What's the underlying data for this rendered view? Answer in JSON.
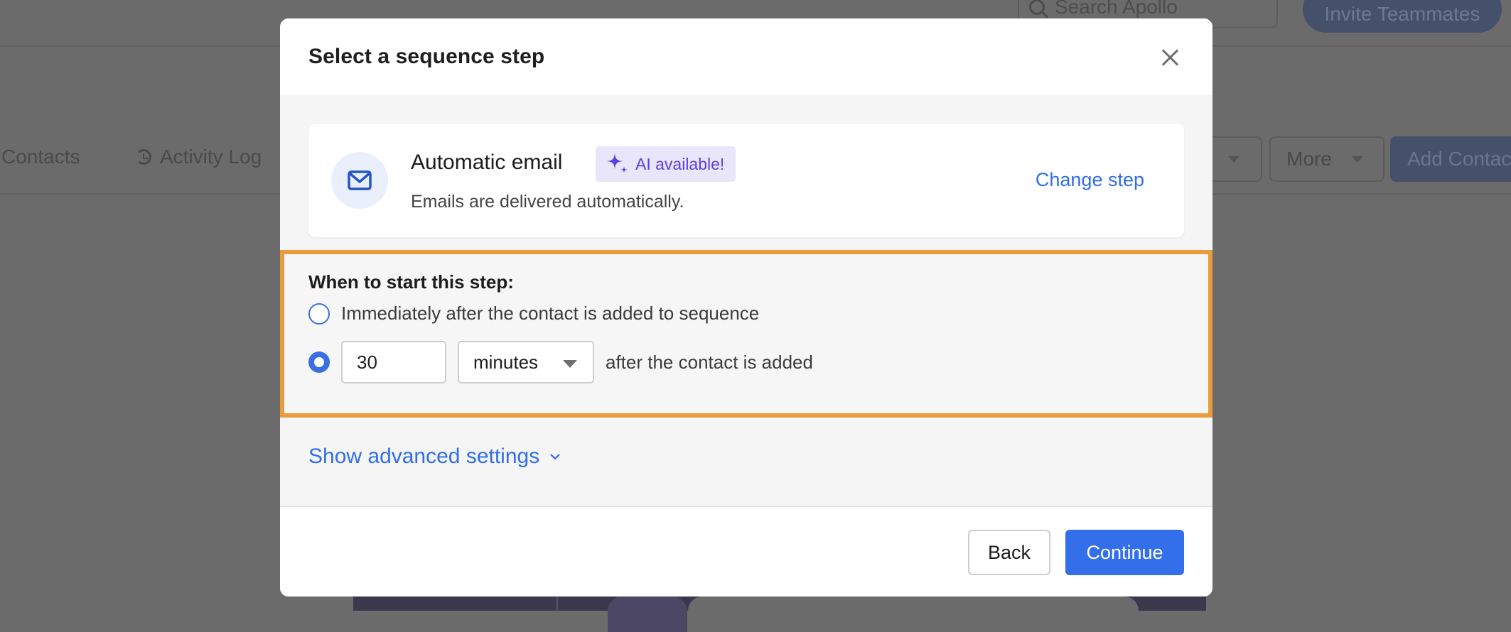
{
  "background": {
    "search_placeholder": "Search Apollo",
    "invite_button": "Invite Teammates",
    "tabs": [
      {
        "label": "Contacts"
      },
      {
        "label": "Activity Log",
        "icon": "history-icon"
      }
    ],
    "more_button": "More",
    "add_contacts_button": "Add Contac"
  },
  "modal": {
    "title": "Select a sequence step",
    "close_icon": "close-icon",
    "step": {
      "icon": "mail-icon",
      "name": "Automatic email",
      "badge": "AI available!",
      "badge_icon": "sparkle-icon",
      "description": "Emails are delivered automatically.",
      "change_link": "Change step"
    },
    "timing": {
      "label": "When to start this step:",
      "option_immediate": "Immediately after the contact is added to sequence",
      "option_immediate_selected": false,
      "option_delay_selected": true,
      "delay_value": "30",
      "delay_unit": "minutes",
      "delay_suffix": "after the contact is added"
    },
    "advanced_link": "Show advanced settings",
    "footer": {
      "back": "Back",
      "continue": "Continue"
    }
  },
  "colors": {
    "accent": "#346feb",
    "highlight_border": "#ea9b3b",
    "ai_badge_bg": "#e9e5fb",
    "ai_badge_text": "#5b3fe0",
    "overlay": "#6b6b6b"
  }
}
